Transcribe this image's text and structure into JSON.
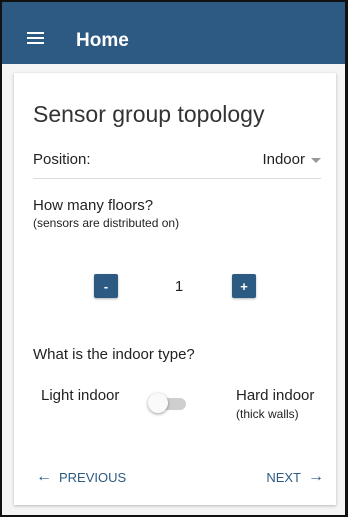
{
  "header": {
    "title": "Home",
    "menu_icon": "hamburger-menu-icon",
    "color": "#2d5a82"
  },
  "card": {
    "title": "Sensor group topology",
    "position": {
      "label": "Position:",
      "value": "Indoor"
    },
    "floors": {
      "question": "How many floors?",
      "subtext": "(sensors are distributed on)",
      "minus_label": "-",
      "plus_label": "+",
      "value": "1"
    },
    "indoor_type": {
      "question": "What is the indoor type?",
      "light_label": "Light indoor",
      "hard_label": "Hard indoor",
      "hard_subtext": "(thick walls)",
      "toggle_on": false
    },
    "navigation": {
      "previous_label": "PREVIOUS",
      "next_label": "NEXT",
      "previous_arrow": "←",
      "next_arrow": "→"
    }
  }
}
